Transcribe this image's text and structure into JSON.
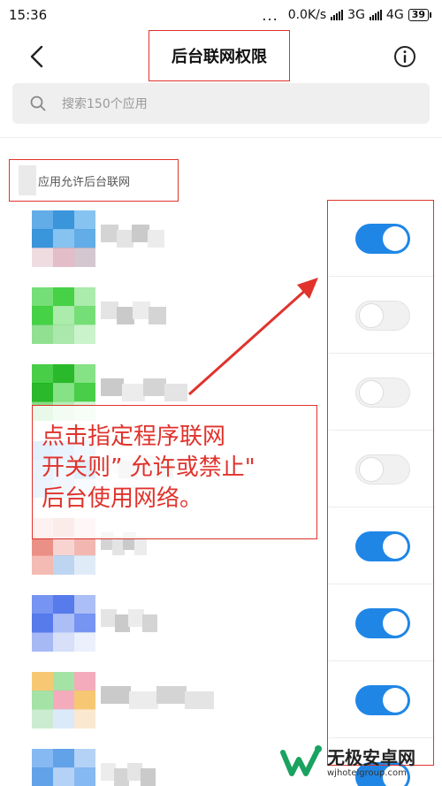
{
  "status_bar": {
    "time": "15:36",
    "dots": "...",
    "speed": "0.0K/s",
    "network1": "3G",
    "network2": "4G",
    "battery": "39"
  },
  "header": {
    "title": "后台联网权限",
    "back_icon": "chevron-left-icon",
    "info_icon": "info-icon"
  },
  "search": {
    "placeholder": "搜索150个应用",
    "icon": "search-icon"
  },
  "section": {
    "label": "应用允许后台联网"
  },
  "apps": [
    {
      "enabled": true
    },
    {
      "enabled": false
    },
    {
      "enabled": false
    },
    {
      "enabled": false
    },
    {
      "enabled": true
    },
    {
      "enabled": true
    },
    {
      "enabled": true
    },
    {
      "enabled": true
    }
  ],
  "annotation": {
    "lines": [
      "点击指定程序联网",
      "开关则” 允许或禁止\"",
      "后台使用网络。"
    ]
  },
  "watermark": {
    "title": "无极安卓网",
    "url": "wjhotelgroup.com"
  },
  "colors": {
    "accent": "#1f86e6",
    "annotation": "#e0332c"
  }
}
